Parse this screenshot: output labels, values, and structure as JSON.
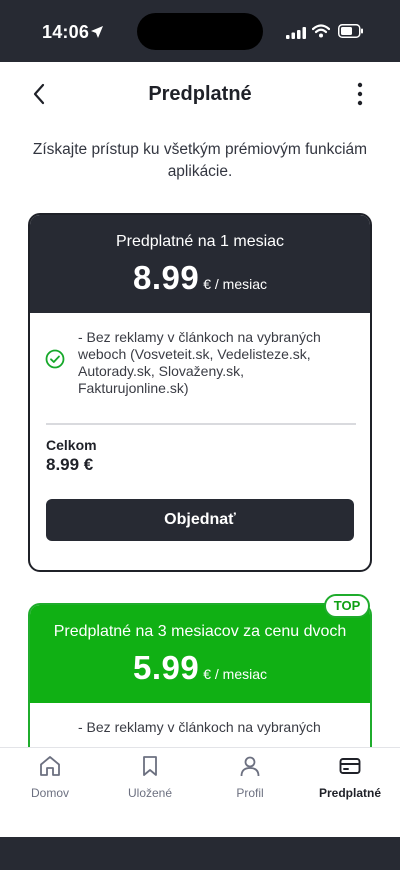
{
  "status_bar": {
    "time": "14:06"
  },
  "header": {
    "title": "Predplatné"
  },
  "intro": "Získajte prístup ku všetkým prémiovým funkciám aplikácie.",
  "plans": [
    {
      "name": "Predplatné na 1 mesiac",
      "price": "8.99",
      "unit": "€ / mesiac",
      "feature": "- Bez reklamy v článkoch na vybraných weboch (Vosveteit.sk, Vedelisteze.sk, Autorady.sk, Slovaženy.sk, Fakturujonline.sk)",
      "total_label": "Celkom",
      "total_value": "8.99 €",
      "button_label": "Objednať"
    },
    {
      "name": "Predplatné na 3 mesiacov za cenu dvoch",
      "price": "5.99",
      "unit": "€ / mesiac",
      "badge": "TOP",
      "feature": "- Bez reklamy v článkoch na vybraných"
    }
  ],
  "tabs": [
    {
      "label": "Domov",
      "icon": "home-icon"
    },
    {
      "label": "Uložené",
      "icon": "bookmark-icon"
    },
    {
      "label": "Profil",
      "icon": "profile-icon"
    },
    {
      "label": "Predplatné",
      "icon": "card-icon"
    }
  ],
  "colors": {
    "dark": "#272a33",
    "accent_green": "#10b014",
    "white": "#ffffff"
  }
}
